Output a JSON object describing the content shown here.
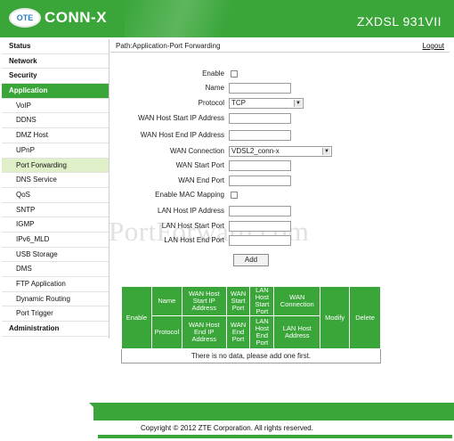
{
  "header": {
    "logo_badge": "OTE",
    "logo_text": "CONN-X",
    "model": "ZXDSL 931VII"
  },
  "sidebar": {
    "items": [
      {
        "label": "Status"
      },
      {
        "label": "Network"
      },
      {
        "label": "Security"
      },
      {
        "label": "Application"
      },
      {
        "label": "VoIP"
      },
      {
        "label": "DDNS"
      },
      {
        "label": "DMZ Host"
      },
      {
        "label": "UPnP"
      },
      {
        "label": "Port Forwarding"
      },
      {
        "label": "DNS Service"
      },
      {
        "label": "QoS"
      },
      {
        "label": "SNTP"
      },
      {
        "label": "IGMP"
      },
      {
        "label": "IPv6_MLD"
      },
      {
        "label": "USB Storage"
      },
      {
        "label": "DMS"
      },
      {
        "label": "FTP Application"
      },
      {
        "label": "Dynamic Routing"
      },
      {
        "label": "Port Trigger"
      },
      {
        "label": "Administration"
      }
    ]
  },
  "pathbar": {
    "path": "Path:Application-Port Forwarding",
    "logout": "Logout"
  },
  "form": {
    "enable": "Enable",
    "name": "Name",
    "protocol": "Protocol",
    "protocol_value": "TCP",
    "wan_start_ip": "WAN Host Start IP Address",
    "wan_end_ip": "WAN Host End IP Address",
    "wan_connection": "WAN Connection",
    "wan_connection_value": "VDSL2_conn-x",
    "wan_start_port": "WAN Start Port",
    "wan_end_port": "WAN End Port",
    "enable_mac": "Enable MAC Mapping",
    "lan_ip": "LAN Host IP Address",
    "lan_start_port": "LAN Host Start Port",
    "lan_end_port": "LAN Host End Port",
    "add_button": "Add"
  },
  "watermark": "PortForward.com",
  "table": {
    "h_enable": "Enable",
    "h_name": "Name",
    "h_wan_start_ip": "WAN Host Start IP Address",
    "h_wan_start_port": "WAN Start Port",
    "h_lan_start_port": "LAN Host Start Port",
    "h_wan_connection": "WAN Connection",
    "h_modify": "Modify",
    "h_delete": "Delete",
    "h_protocol": "Protocol",
    "h_wan_end_ip": "WAN Host End IP Address",
    "h_wan_end_port": "WAN End Port",
    "h_lan_end_port": "LAN Host End Port",
    "h_lan_host_address": "LAN Host Address",
    "empty": "There is no data, please add one first."
  },
  "footer": {
    "copyright": "Copyright © 2012 ZTE Corporation. All rights reserved."
  }
}
